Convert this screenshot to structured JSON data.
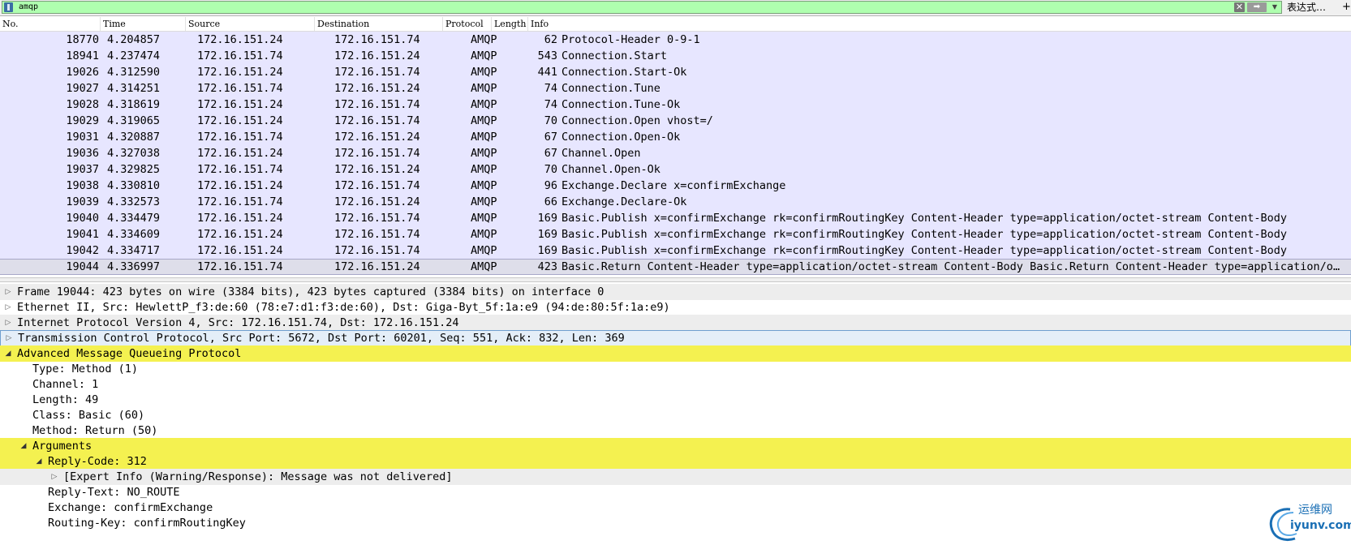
{
  "filter": {
    "value": "amqp",
    "clear_icon": "close-icon",
    "apply_icon": "arrow-right-icon",
    "dropdown_icon": "chevron-down-icon",
    "expression_label": "表达式…",
    "add_label": "+",
    "background_color": "#afffaf"
  },
  "packet_list": {
    "columns": [
      "No.",
      "Time",
      "Source",
      "Destination",
      "Protocol",
      "Length",
      "Info"
    ],
    "row_color": "#e7e6ff",
    "rows": [
      {
        "no": "18770",
        "time": "4.204857",
        "src": "172.16.151.24",
        "dst": "172.16.151.74",
        "proto": "AMQP",
        "len": "62",
        "info": "Protocol-Header 0-9-1"
      },
      {
        "no": "18941",
        "time": "4.237474",
        "src": "172.16.151.74",
        "dst": "172.16.151.24",
        "proto": "AMQP",
        "len": "543",
        "info": "Connection.Start"
      },
      {
        "no": "19026",
        "time": "4.312590",
        "src": "172.16.151.24",
        "dst": "172.16.151.74",
        "proto": "AMQP",
        "len": "441",
        "info": "Connection.Start-Ok"
      },
      {
        "no": "19027",
        "time": "4.314251",
        "src": "172.16.151.74",
        "dst": "172.16.151.24",
        "proto": "AMQP",
        "len": "74",
        "info": "Connection.Tune"
      },
      {
        "no": "19028",
        "time": "4.318619",
        "src": "172.16.151.24",
        "dst": "172.16.151.74",
        "proto": "AMQP",
        "len": "74",
        "info": "Connection.Tune-Ok"
      },
      {
        "no": "19029",
        "time": "4.319065",
        "src": "172.16.151.24",
        "dst": "172.16.151.74",
        "proto": "AMQP",
        "len": "70",
        "info": "Connection.Open vhost=/"
      },
      {
        "no": "19031",
        "time": "4.320887",
        "src": "172.16.151.74",
        "dst": "172.16.151.24",
        "proto": "AMQP",
        "len": "67",
        "info": "Connection.Open-Ok"
      },
      {
        "no": "19036",
        "time": "4.327038",
        "src": "172.16.151.24",
        "dst": "172.16.151.74",
        "proto": "AMQP",
        "len": "67",
        "info": "Channel.Open"
      },
      {
        "no": "19037",
        "time": "4.329825",
        "src": "172.16.151.74",
        "dst": "172.16.151.24",
        "proto": "AMQP",
        "len": "70",
        "info": "Channel.Open-Ok"
      },
      {
        "no": "19038",
        "time": "4.330810",
        "src": "172.16.151.24",
        "dst": "172.16.151.74",
        "proto": "AMQP",
        "len": "96",
        "info": "Exchange.Declare x=confirmExchange"
      },
      {
        "no": "19039",
        "time": "4.332573",
        "src": "172.16.151.74",
        "dst": "172.16.151.24",
        "proto": "AMQP",
        "len": "66",
        "info": "Exchange.Declare-Ok"
      },
      {
        "no": "19040",
        "time": "4.334479",
        "src": "172.16.151.24",
        "dst": "172.16.151.74",
        "proto": "AMQP",
        "len": "169",
        "info": "Basic.Publish x=confirmExchange rk=confirmRoutingKey Content-Header type=application/octet-stream Content-Body"
      },
      {
        "no": "19041",
        "time": "4.334609",
        "src": "172.16.151.24",
        "dst": "172.16.151.74",
        "proto": "AMQP",
        "len": "169",
        "info": "Basic.Publish x=confirmExchange rk=confirmRoutingKey Content-Header type=application/octet-stream Content-Body"
      },
      {
        "no": "19042",
        "time": "4.334717",
        "src": "172.16.151.24",
        "dst": "172.16.151.74",
        "proto": "AMQP",
        "len": "169",
        "info": "Basic.Publish x=confirmExchange rk=confirmRoutingKey Content-Header type=application/octet-stream Content-Body"
      },
      {
        "no": "19044",
        "time": "4.336997",
        "src": "172.16.151.74",
        "dst": "172.16.151.24",
        "proto": "AMQP",
        "len": "423",
        "info": "Basic.Return Content-Header type=application/octet-stream Content-Body Basic.Return Content-Header type=application/oct…",
        "selected": true
      }
    ]
  },
  "details": {
    "highlight_color": "#f4f150",
    "rows": [
      {
        "text": "Frame 19044: 423 bytes on wire (3384 bits), 423 bytes captured (3384 bits) on interface 0",
        "indent": 0,
        "toggle": "collapsed",
        "bg": "gray"
      },
      {
        "text": "Ethernet II, Src: HewlettP_f3:de:60 (78:e7:d1:f3:de:60), Dst: Giga-Byt_5f:1a:e9 (94:de:80:5f:1a:e9)",
        "indent": 0,
        "toggle": "collapsed",
        "bg": "none"
      },
      {
        "text": "Internet Protocol Version 4, Src: 172.16.151.74, Dst: 172.16.151.24",
        "indent": 0,
        "toggle": "collapsed",
        "bg": "gray"
      },
      {
        "text": "Transmission Control Protocol, Src Port: 5672, Dst Port: 60201, Seq: 551, Ack: 832, Len: 369",
        "indent": 0,
        "toggle": "collapsed",
        "bg": "selected"
      },
      {
        "text": "Advanced Message Queueing Protocol",
        "indent": 0,
        "toggle": "expanded",
        "bg": "yellow"
      },
      {
        "text": "Type: Method (1)",
        "indent": 1,
        "toggle": "none",
        "bg": "none"
      },
      {
        "text": "Channel: 1",
        "indent": 1,
        "toggle": "none",
        "bg": "none"
      },
      {
        "text": "Length: 49",
        "indent": 1,
        "toggle": "none",
        "bg": "none"
      },
      {
        "text": "Class: Basic (60)",
        "indent": 1,
        "toggle": "none",
        "bg": "none"
      },
      {
        "text": "Method: Return (50)",
        "indent": 1,
        "toggle": "none",
        "bg": "none"
      },
      {
        "text": "Arguments",
        "indent": 1,
        "toggle": "expanded",
        "bg": "yellow"
      },
      {
        "text": "Reply-Code: 312",
        "indent": 2,
        "toggle": "expanded",
        "bg": "yellow"
      },
      {
        "text": "[Expert Info (Warning/Response): Message was not delivered]",
        "indent": 3,
        "toggle": "collapsed",
        "bg": "gray"
      },
      {
        "text": "Reply-Text: NO_ROUTE",
        "indent": 2,
        "toggle": "none",
        "bg": "none"
      },
      {
        "text": "Exchange: confirmExchange",
        "indent": 2,
        "toggle": "none",
        "bg": "none"
      },
      {
        "text": "Routing-Key: confirmRoutingKey",
        "indent": 2,
        "toggle": "none",
        "bg": "none"
      }
    ]
  },
  "watermark": {
    "cn": "运维网",
    "en": "iyunv.com",
    "icon": "swirl-logo-icon",
    "color": "#1a6fb5"
  }
}
